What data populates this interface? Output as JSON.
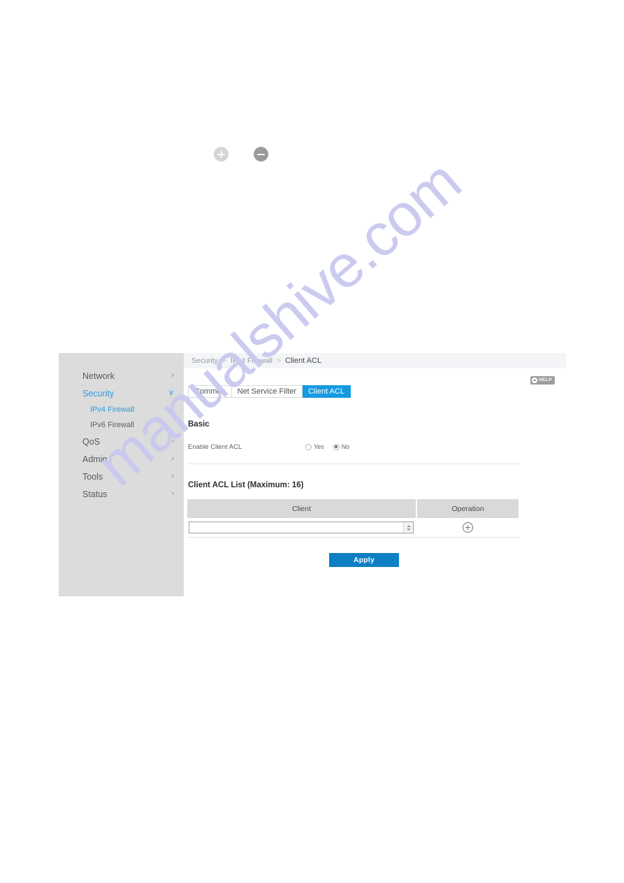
{
  "watermark": {
    "text": "manualshive.com",
    "color": "#c9c9ef"
  },
  "zoom_controls": {
    "zoom_in_label": "+",
    "zoom_out_label": "−",
    "zoom_in_icon": "plus-circle-icon",
    "zoom_out_icon": "minus-circle-icon"
  },
  "sidebar": {
    "items": [
      {
        "label": "Network",
        "chevron": "›",
        "state": "collapsed"
      },
      {
        "label": "Security",
        "chevron": "∨",
        "state": "expanded"
      },
      {
        "label": "QoS",
        "chevron": "›",
        "state": "collapsed"
      },
      {
        "label": "Admin",
        "chevron": "›",
        "state": "collapsed"
      },
      {
        "label": "Tools",
        "chevron": "›",
        "state": "collapsed"
      },
      {
        "label": "Status",
        "chevron": "›",
        "state": "collapsed"
      }
    ],
    "subitems": [
      {
        "label": "IPv4 Firewall",
        "active": true
      },
      {
        "label": "IPv6 Firewall",
        "active": false
      }
    ]
  },
  "breadcrumb": {
    "level1": "Security",
    "level2": "IPv4 Firewall",
    "current": "Client ACL",
    "separator": ">"
  },
  "help": {
    "label": "HELP",
    "icon": "help-circle-icon"
  },
  "tabs": [
    {
      "label": "Common",
      "active": false
    },
    {
      "label": "Net Service Filter",
      "active": false
    },
    {
      "label": "Client ACL",
      "active": true
    }
  ],
  "basic": {
    "heading": "Basic",
    "field_label": "Enable Client ACL",
    "options": [
      {
        "label": "Yes",
        "checked": false
      },
      {
        "label": "No",
        "checked": true
      }
    ]
  },
  "acl_list": {
    "heading": "Client ACL List (Maximum: 16)",
    "columns": [
      "Client",
      "Operation"
    ],
    "rows": [
      {
        "client_value": "",
        "client_placeholder": "",
        "operation_icon": "plus-circle-icon"
      }
    ]
  },
  "actions": {
    "apply_label": "Apply",
    "apply_color": "#0d7fc4"
  }
}
